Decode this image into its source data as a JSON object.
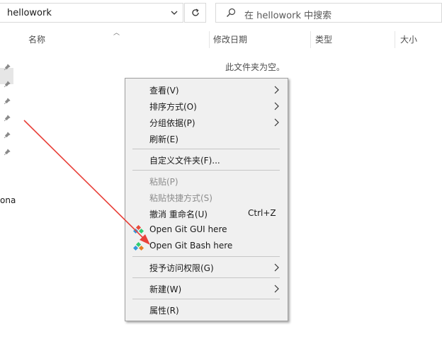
{
  "address_bar": {
    "path": "hellowork"
  },
  "search": {
    "placeholder": "在 hellowork 中搜索"
  },
  "columns": {
    "name": "名称",
    "modified": "修改日期",
    "type": "类型",
    "size": "大小"
  },
  "empty_message": "此文件夹为空。",
  "nav": {
    "partial_text": "ona"
  },
  "context_menu": {
    "view": "查看(V)",
    "sort_by": "排序方式(O)",
    "group_by": "分组依据(P)",
    "refresh": "刷新(E)",
    "customize": "自定义文件夹(F)...",
    "paste": "粘贴(P)",
    "paste_shortcut": "粘贴快捷方式(S)",
    "undo_rename": "撤消 重命名(U)",
    "undo_shortcut": "Ctrl+Z",
    "git_gui": "Open Git GUI here",
    "git_bash": "Open Git Bash here",
    "give_access": "授予访问权限(G)",
    "new": "新建(W)",
    "properties": "属性(R)"
  },
  "colors": {
    "menu_bg": "#f0f0f0",
    "annotation_arrow": "#e8413a",
    "disabled_text": "#8d8d8d"
  }
}
